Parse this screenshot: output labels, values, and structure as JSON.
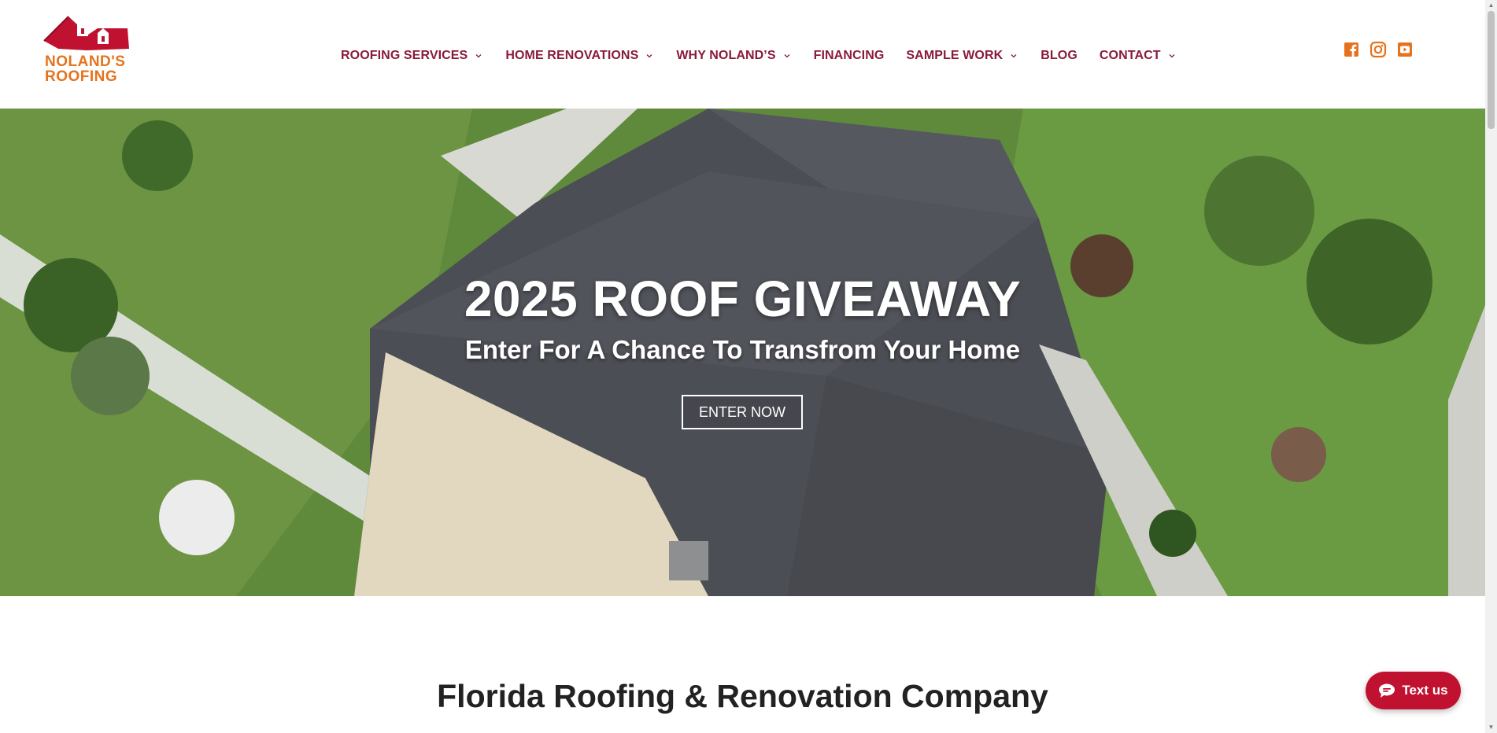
{
  "logo": {
    "line1": "NOLAND'S",
    "line2": "ROOFING"
  },
  "nav": {
    "items": [
      {
        "label": "ROOFING SERVICES",
        "dropdown": true
      },
      {
        "label": "HOME RENOVATIONS",
        "dropdown": true
      },
      {
        "label": "WHY NOLAND’S",
        "dropdown": true
      },
      {
        "label": "FINANCING",
        "dropdown": false
      },
      {
        "label": "SAMPLE WORK",
        "dropdown": true
      },
      {
        "label": "BLOG",
        "dropdown": false
      },
      {
        "label": "CONTACT",
        "dropdown": true
      }
    ]
  },
  "social": {
    "icons": [
      "facebook-icon",
      "instagram-icon",
      "youtube-icon"
    ],
    "color": "#e5731d"
  },
  "hero": {
    "title": "2025 ROOF GIVEAWAY",
    "subtitle": "Enter For A Chance To Transfrom Your Home",
    "button": "ENTER NOW"
  },
  "section": {
    "title": "Florida Roofing & Renovation Company"
  },
  "chat": {
    "label": "Text us"
  },
  "colors": {
    "brand_red": "#c11130",
    "nav_text": "#8a1a3a",
    "accent_orange": "#e5731d"
  }
}
